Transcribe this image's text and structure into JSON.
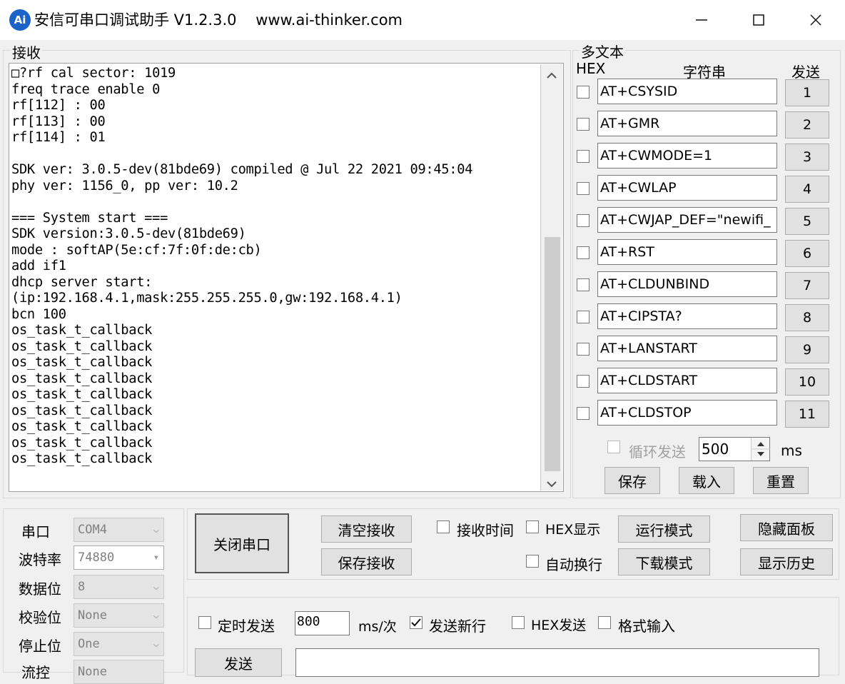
{
  "window": {
    "title": "安信可串口调试助手 V1.2.3.0    www.ai-thinker.com",
    "icon_text": "Ai",
    "controls": [
      "minimize-icon",
      "maximize-icon",
      "close-icon"
    ]
  },
  "receive": {
    "label": "接收",
    "text": "□?rf cal sector: 1019\nfreq trace enable 0\nrf[112] : 00\nrf[113] : 00\nrf[114] : 01\n\nSDK ver: 3.0.5-dev(81bde69) compiled @ Jul 22 2021 09:45:04\nphy ver: 1156_0, pp ver: 10.2\n\n=== System start ===\nSDK version:3.0.5-dev(81bde69)\nmode : softAP(5e:cf:7f:0f:de:cb)\nadd if1\ndhcp server start:\n(ip:192.168.4.1,mask:255.255.255.0,gw:192.168.4.1)\nbcn 100\nos_task_t_callback\nos_task_t_callback\nos_task_t_callback\nos_task_t_callback\nos_task_t_callback\nos_task_t_callback\nos_task_t_callback\nos_task_t_callback\nos_task_t_callback"
  },
  "multitext": {
    "label": "多文本",
    "hex_header": "HEX",
    "string_header": "字符串",
    "send_header": "发送",
    "commands": [
      {
        "text": "AT+CSYSID",
        "button": "1"
      },
      {
        "text": "AT+GMR",
        "button": "2"
      },
      {
        "text": "AT+CWMODE=1",
        "button": "3"
      },
      {
        "text": "AT+CWLAP",
        "button": "4"
      },
      {
        "text": "AT+CWJAP_DEF=\"newifi_",
        "button": "5"
      },
      {
        "text": "AT+RST",
        "button": "6"
      },
      {
        "text": "AT+CLDUNBIND",
        "button": "7"
      },
      {
        "text": "AT+CIPSTA?",
        "button": "8"
      },
      {
        "text": "AT+LANSTART",
        "button": "9"
      },
      {
        "text": "AT+CLDSTART",
        "button": "10"
      },
      {
        "text": "AT+CLDSTOP",
        "button": "11"
      }
    ],
    "loop_send_label": "循环发送",
    "loop_interval": "500",
    "loop_unit": "ms",
    "save_label": "保存",
    "load_label": "载入",
    "reset_label": "重置"
  },
  "port_settings": {
    "port_label": "串口",
    "port_value": "COM4",
    "baud_label": "波特率",
    "baud_value": "74880",
    "databits_label": "数据位",
    "databits_value": "8",
    "parity_label": "校验位",
    "parity_value": "None",
    "stopbits_label": "停止位",
    "stopbits_value": "One",
    "flow_label": "流控",
    "flow_value": "None"
  },
  "controls": {
    "close_port": "关闭串口",
    "clear_receive": "清空接收",
    "save_receive": "保存接收",
    "receive_time": "接收时间",
    "hex_display": "HEX显示",
    "auto_wrap": "自动换行",
    "run_mode": "运行模式",
    "download_mode": "下载模式",
    "hide_panel": "隐藏面板",
    "show_history": "显示历史"
  },
  "send_panel": {
    "timed_send": "定时发送",
    "interval": "800",
    "interval_unit": "ms/次",
    "send_newline": "发送新行",
    "send_newline_checked": true,
    "hex_send": "HEX发送",
    "format_input": "格式输入",
    "send_button": "发送"
  }
}
